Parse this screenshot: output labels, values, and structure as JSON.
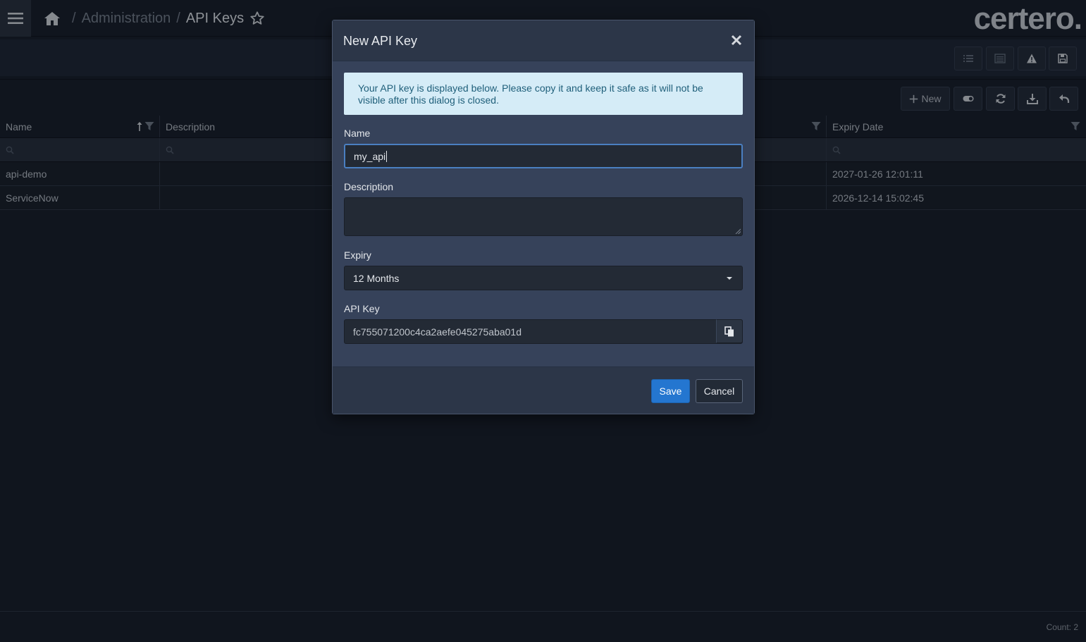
{
  "header": {
    "breadcrumb_admin": "Administration",
    "breadcrumb_sep": "/",
    "page_title": "API Keys",
    "logo": "certero."
  },
  "toolbar": {
    "new_label": "New"
  },
  "table": {
    "columns": [
      "Name",
      "Description",
      "Expiry Date"
    ],
    "rows": [
      {
        "name": "api-demo",
        "description": "",
        "expiry": "2027-01-26 12:01:11"
      },
      {
        "name": "ServiceNow",
        "description": "",
        "expiry": "2026-12-14 15:02:45"
      }
    ],
    "sorted_column": "Name",
    "sort_direction": "ascending"
  },
  "footer": {
    "count": "Count: 2"
  },
  "dialog": {
    "title": "New API Key",
    "alert_text": "Your API key is displayed below. Please copy it and keep it safe as it will not be visible after this dialog is closed.",
    "name_label": "Name",
    "name_value": "my_api",
    "description_label": "Description",
    "description_value": "",
    "expiry_label": "Expiry",
    "expiry_value": "12 Months",
    "api_key_label": "API Key",
    "api_key_value": "fc755071200c4ca2aefe045275aba01d",
    "save_label": "Save",
    "cancel_label": "Cancel"
  },
  "icons": {
    "menu": "hamburger-icon",
    "home": "home-icon",
    "favorite": "star-outline-icon",
    "list": "list-icon",
    "details": "details-icon",
    "warning": "warning-icon",
    "save": "floppy-disk-icon",
    "add": "plus-icon",
    "toggle": "toggle-icon",
    "refresh": "refresh-icon",
    "export": "download-icon",
    "undo": "undo-icon",
    "filter": "filter-icon",
    "search": "search-icon",
    "close": "close-icon",
    "copy": "copy-icon"
  },
  "colors": {
    "background": "#151b25",
    "modal_body": "#36425a",
    "primary_button": "#2476d0",
    "alert_background": "#d5ecf7",
    "alert_text": "#1f5f7a"
  }
}
